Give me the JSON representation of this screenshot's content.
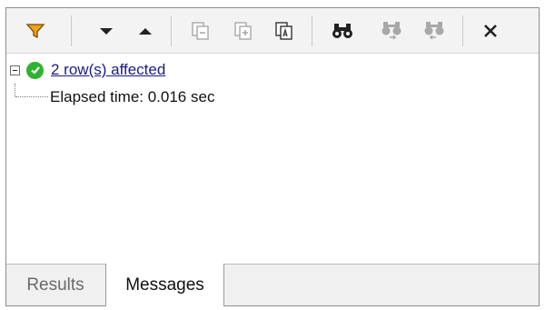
{
  "toolbar": {
    "buttons": [
      {
        "icon": "filter-icon",
        "enabled": true
      },
      {
        "icon": "next-arrow-icon",
        "enabled": true
      },
      {
        "icon": "previous-arrow-icon",
        "enabled": true
      },
      {
        "icon": "copy-cell-icon",
        "enabled": false
      },
      {
        "icon": "copy-row-icon",
        "enabled": false
      },
      {
        "icon": "copy-all-icon",
        "enabled": true
      },
      {
        "icon": "find-icon",
        "enabled": true
      },
      {
        "icon": "find-next-icon",
        "enabled": false
      },
      {
        "icon": "find-previous-icon",
        "enabled": false
      },
      {
        "icon": "close-icon",
        "enabled": true
      }
    ],
    "colors": {
      "filter": "#f2a21b",
      "enabled": "#222222",
      "disabled": "#a8a8a8"
    }
  },
  "messages": {
    "summary": "2 row(s) affected",
    "detail": "Elapsed time: 0.016 sec",
    "status_color": "#2db32e"
  },
  "tabs": [
    {
      "label": "Results",
      "active": false
    },
    {
      "label": "Messages",
      "active": true
    }
  ]
}
